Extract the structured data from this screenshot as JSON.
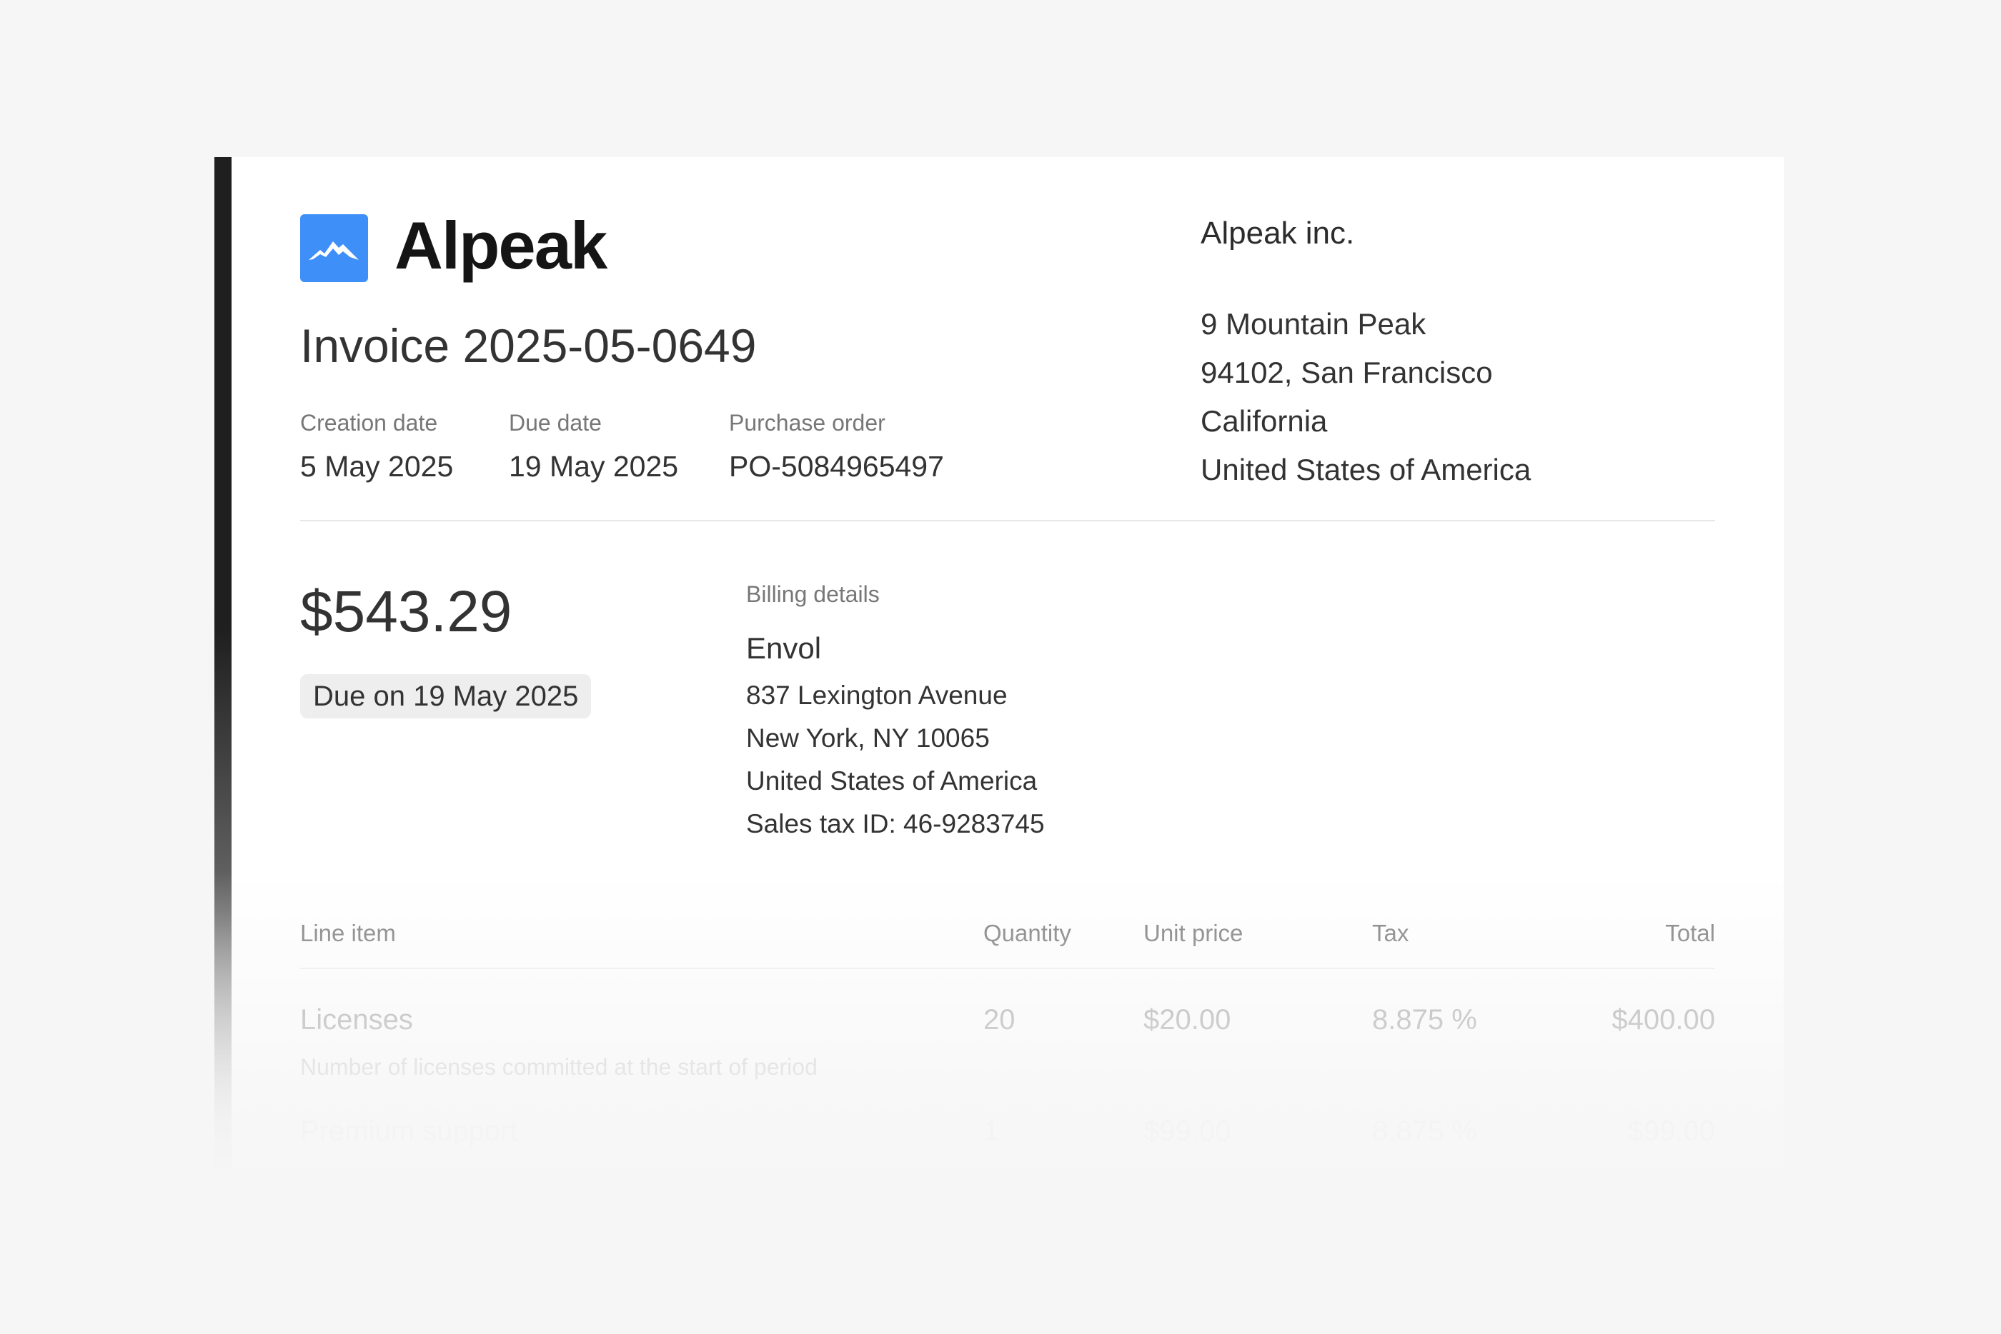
{
  "company": {
    "brand": "Alpeak",
    "legal_name": "Alpeak inc.",
    "address": [
      "9 Mountain Peak",
      "94102, San Francisco",
      "California",
      "United States of America"
    ]
  },
  "invoice": {
    "title": "Invoice 2025-05-0649",
    "creation_label": "Creation date",
    "creation_value": "5 May 2025",
    "due_label": "Due date",
    "due_value": "19 May 2025",
    "po_label": "Purchase order",
    "po_value": "PO-5084965497"
  },
  "summary": {
    "amount": "$543.29",
    "due_badge": "Due on 19 May 2025"
  },
  "billing": {
    "label": "Billing details",
    "name": "Envol",
    "lines": [
      "837 Lexington Avenue",
      "New York, NY 10065",
      "United States of America",
      "Sales tax ID: 46-9283745"
    ]
  },
  "table": {
    "headers": {
      "item": "Line item",
      "quantity": "Quantity",
      "unit_price": "Unit price",
      "tax": "Tax",
      "total": "Total"
    },
    "rows": [
      {
        "item": "Licenses",
        "description": "Number of licenses committed at the start of period",
        "quantity": "20",
        "unit_price": "$20.00",
        "tax": "8.875 %",
        "total": "$400.00"
      },
      {
        "item": "Premium support",
        "quantity": "1",
        "unit_price": "$99.00",
        "tax": "8.875 %",
        "total": "$99.00"
      }
    ]
  },
  "icons": {
    "logo": "mountain-logo-icon"
  },
  "colors": {
    "brand_blue": "#3e8ff7",
    "accent_bar": "#1f1f1f"
  }
}
